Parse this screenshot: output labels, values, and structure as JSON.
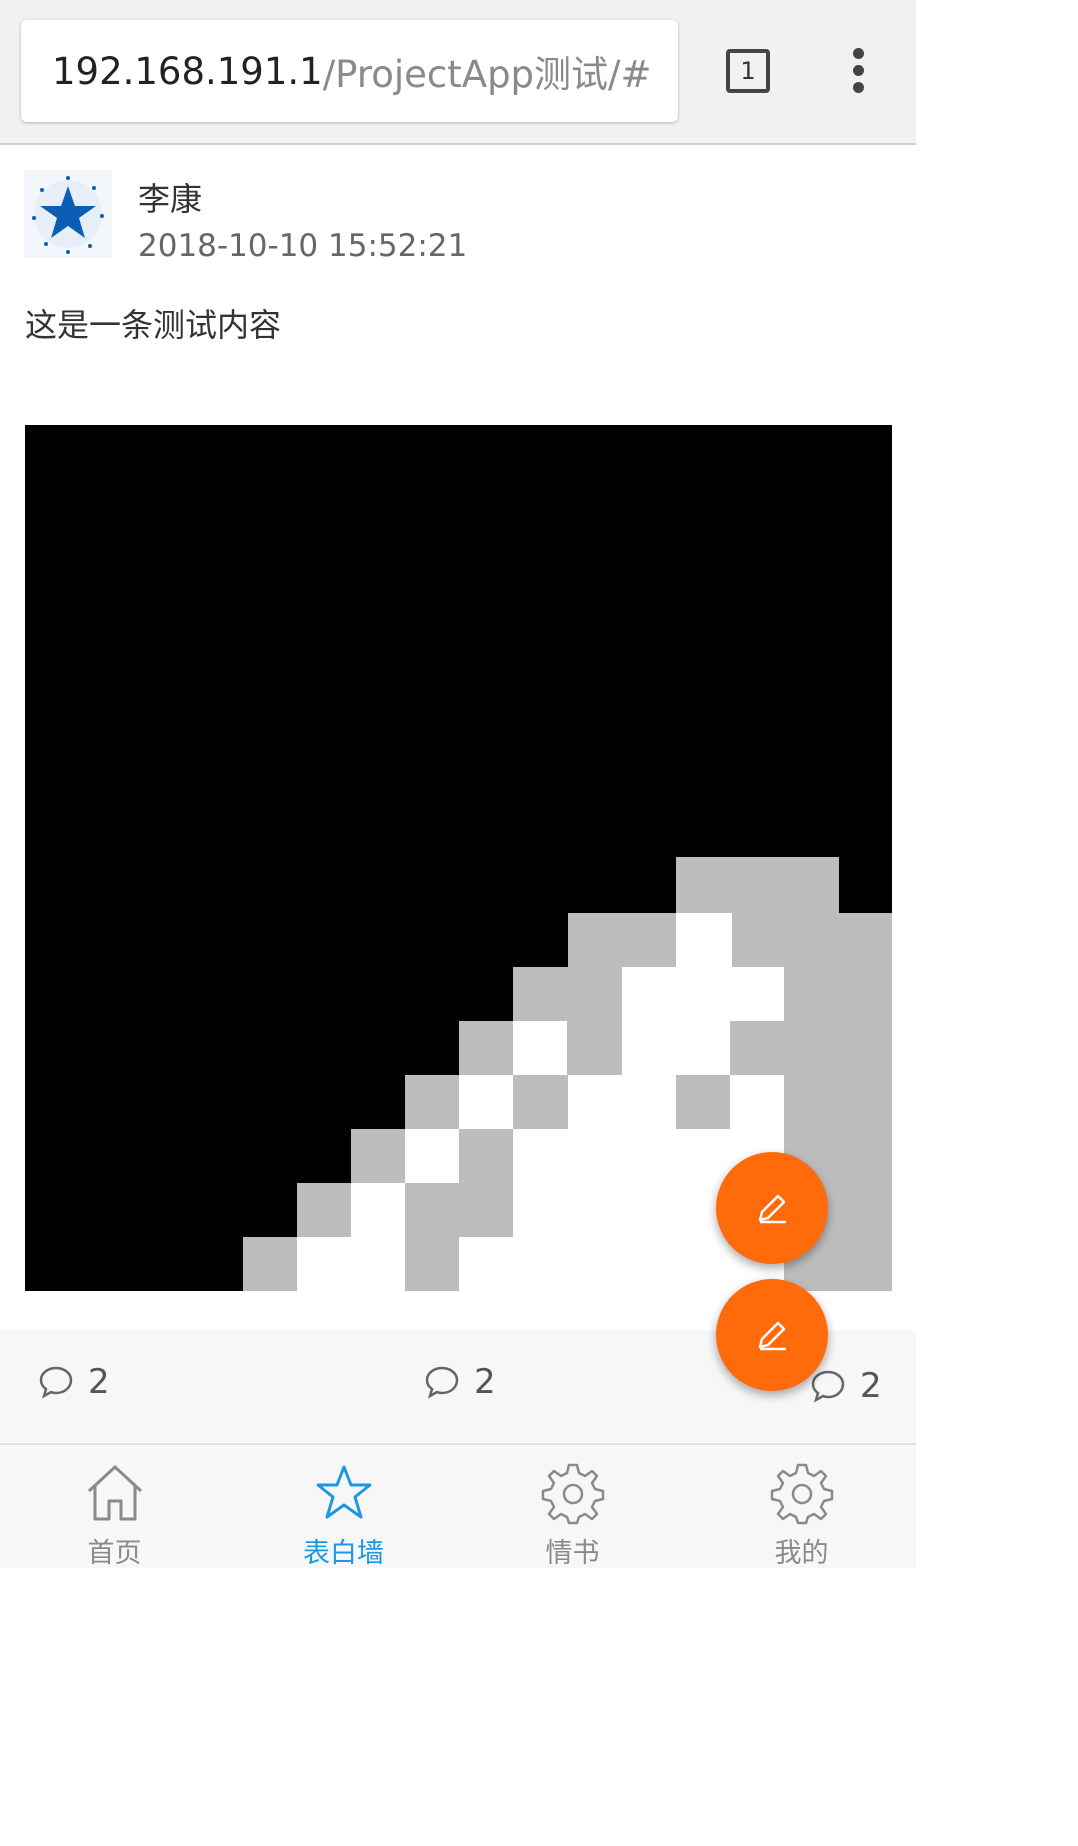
{
  "browser": {
    "url_host": "192.168.191.1",
    "url_path": "/ProjectApp测试/#",
    "tab_count": "1",
    "menu_icon": "more-vertical-icon"
  },
  "post": {
    "avatar_icon": "star-avatar-icon",
    "author": "李康",
    "timestamp": "2018-10-10 15:52:21",
    "text": "这是一条测试内容"
  },
  "actions": {
    "comments": [
      {
        "icon": "comment-icon",
        "count": "2"
      },
      {
        "icon": "comment-icon",
        "count": "2"
      },
      {
        "icon": "comment-icon",
        "count": "2"
      }
    ]
  },
  "fab": {
    "icon": "edit-pencil-icon",
    "color": "#ff6a0a"
  },
  "bottom_nav": {
    "active_color": "#1e96e6",
    "items": [
      {
        "label": "首页",
        "icon": "home-icon"
      },
      {
        "label": "表白墙",
        "icon": "star-icon"
      },
      {
        "label": "情书",
        "icon": "gear-icon"
      },
      {
        "label": "我的",
        "icon": "gear-icon"
      }
    ]
  }
}
